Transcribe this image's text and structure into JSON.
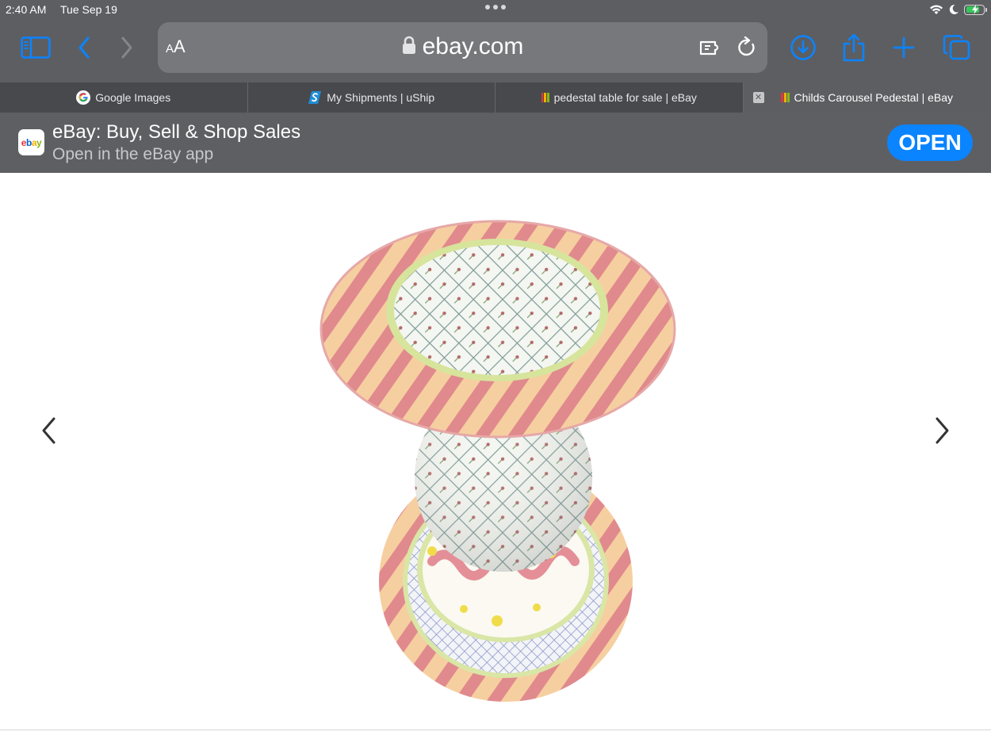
{
  "status_bar": {
    "time": "2:40 AM",
    "date": "Tue Sep 19",
    "battery_charge": 0.8
  },
  "browser": {
    "address": {
      "text_size_small": "A",
      "text_size_large": "A",
      "domain": "ebay.com"
    },
    "tabs": [
      {
        "label": "Google Images",
        "favicon": "google-icon"
      },
      {
        "label": "My Shipments | uShip",
        "favicon": "uship-icon"
      },
      {
        "label": "pedestal table for sale | eBay",
        "favicon": "ebay-favicon"
      },
      {
        "label": "Childs Carousel Pedestal | eBay",
        "favicon": "ebay-favicon",
        "active": true
      }
    ]
  },
  "app_banner": {
    "title": "eBay: Buy, Sell & Shop Sales",
    "subtitle": "Open in the eBay app",
    "open_label": "OPEN",
    "logo_letters": [
      "e",
      "b",
      "a",
      "y"
    ]
  },
  "colors": {
    "accent": "#0a84ff",
    "chrome": "#5d5e62",
    "ebay_red": "#e53238",
    "ebay_blue": "#0064d2",
    "ebay_yellow": "#f5af02",
    "ebay_green": "#86b817"
  }
}
